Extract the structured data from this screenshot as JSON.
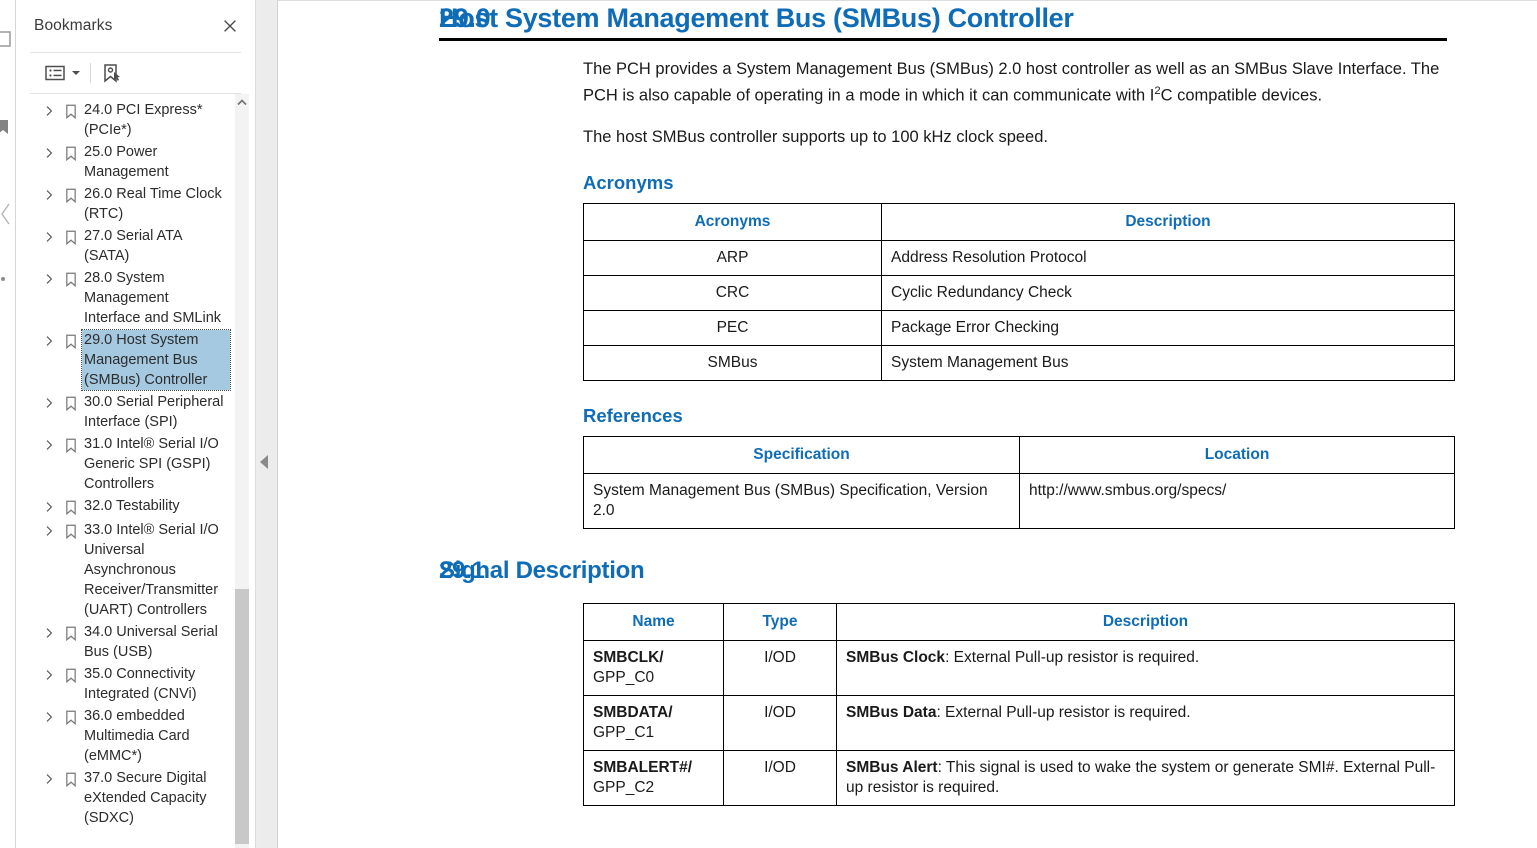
{
  "left_rail": {
    "icons": [
      "thumbnail-icon",
      "bookmark-icon",
      "attachment-icon",
      "collapse-chevron-icon"
    ]
  },
  "bookmarks_panel": {
    "title": "Bookmarks",
    "close_icon": "close-icon",
    "toolbar": {
      "options_icon": "list-options-icon",
      "caret_icon": "chevron-down-icon",
      "new_bookmark_icon": "new-bookmark-icon"
    },
    "scrollbar": {
      "up_icon": "chevron-up-icon"
    },
    "items": [
      {
        "label": "24.0 PCI Express* (PCIe*)",
        "selected": false
      },
      {
        "label": "25.0 Power Management",
        "selected": false
      },
      {
        "label": "26.0 Real Time Clock (RTC)",
        "selected": false
      },
      {
        "label": "27.0 Serial ATA (SATA)",
        "selected": false
      },
      {
        "label": "28.0 System Management Interface and SMLink",
        "selected": false
      },
      {
        "label": "29.0 Host System Management Bus (SMBus) Controller",
        "selected": true
      },
      {
        "label": "30.0 Serial Peripheral Interface (SPI)",
        "selected": false
      },
      {
        "label": "31.0 Intel® Serial I/O Generic SPI (GSPI) Controllers",
        "selected": false
      },
      {
        "label": "32.0 Testability",
        "selected": false
      },
      {
        "label": "33.0 Intel® Serial I/O Universal Asynchronous Receiver/Transmitter (UART) Controllers",
        "selected": false
      },
      {
        "label": "34.0 Universal Serial Bus (USB)",
        "selected": false
      },
      {
        "label": "35.0 Connectivity Integrated (CNVi)",
        "selected": false
      },
      {
        "label": "36.0 embedded Multimedia Card (eMMC*)",
        "selected": false
      },
      {
        "label": "37.0 Secure Digital eXtended Capacity (SDXC)",
        "selected": false
      }
    ]
  },
  "splitter": {
    "collapse_icon": "collapse-left-icon"
  },
  "document": {
    "section": {
      "number": "29.0",
      "title": "Host System Management Bus (SMBus) Controller"
    },
    "paragraph_1_a": "The PCH provides a System Management Bus (SMBus) 2.0 host controller as well as an SMBus Slave Interface. The PCH is also capable of operating in a mode in which it can communicate with I",
    "paragraph_1_sup": "2",
    "paragraph_1_b": "C compatible devices.",
    "paragraph_2": "The host SMBus controller supports up to 100 kHz clock speed.",
    "acronyms": {
      "heading": "Acronyms",
      "columns": [
        "Acronyms",
        "Description"
      ],
      "rows": [
        [
          "ARP",
          "Address Resolution Protocol"
        ],
        [
          "CRC",
          "Cyclic Redundancy Check"
        ],
        [
          "PEC",
          "Package Error Checking"
        ],
        [
          "SMBus",
          "System Management Bus"
        ]
      ]
    },
    "references": {
      "heading": "References",
      "columns": [
        "Specification",
        "Location"
      ],
      "rows": [
        [
          "System Management Bus (SMBus) Specification, Version 2.0",
          "http://www.smbus.org/specs/"
        ]
      ]
    },
    "signal": {
      "number": "29.1",
      "title": "Signal Description",
      "columns": [
        "Name",
        "Type",
        "Description"
      ],
      "rows": [
        {
          "name": "SMBCLK/",
          "pad": "GPP_C0",
          "type": "I/OD",
          "desc_bold": "SMBus Clock",
          "desc_rest": ": External Pull-up resistor is required."
        },
        {
          "name": "SMBDATA/",
          "pad": "GPP_C1",
          "type": "I/OD",
          "desc_bold": "SMBus Data",
          "desc_rest": ": External Pull-up resistor is required."
        },
        {
          "name": "SMBALERT#/",
          "pad": "GPP_C2",
          "type": "I/OD",
          "desc_bold": "SMBus Alert",
          "desc_rest": ": This signal is used to wake the system or generate SMI#. External Pull-up resistor is required."
        }
      ]
    }
  },
  "colors": {
    "heading_blue": "#0f6cb6",
    "selection_blue": "#a6c9e2",
    "panel_border": "#dcdcdc"
  }
}
